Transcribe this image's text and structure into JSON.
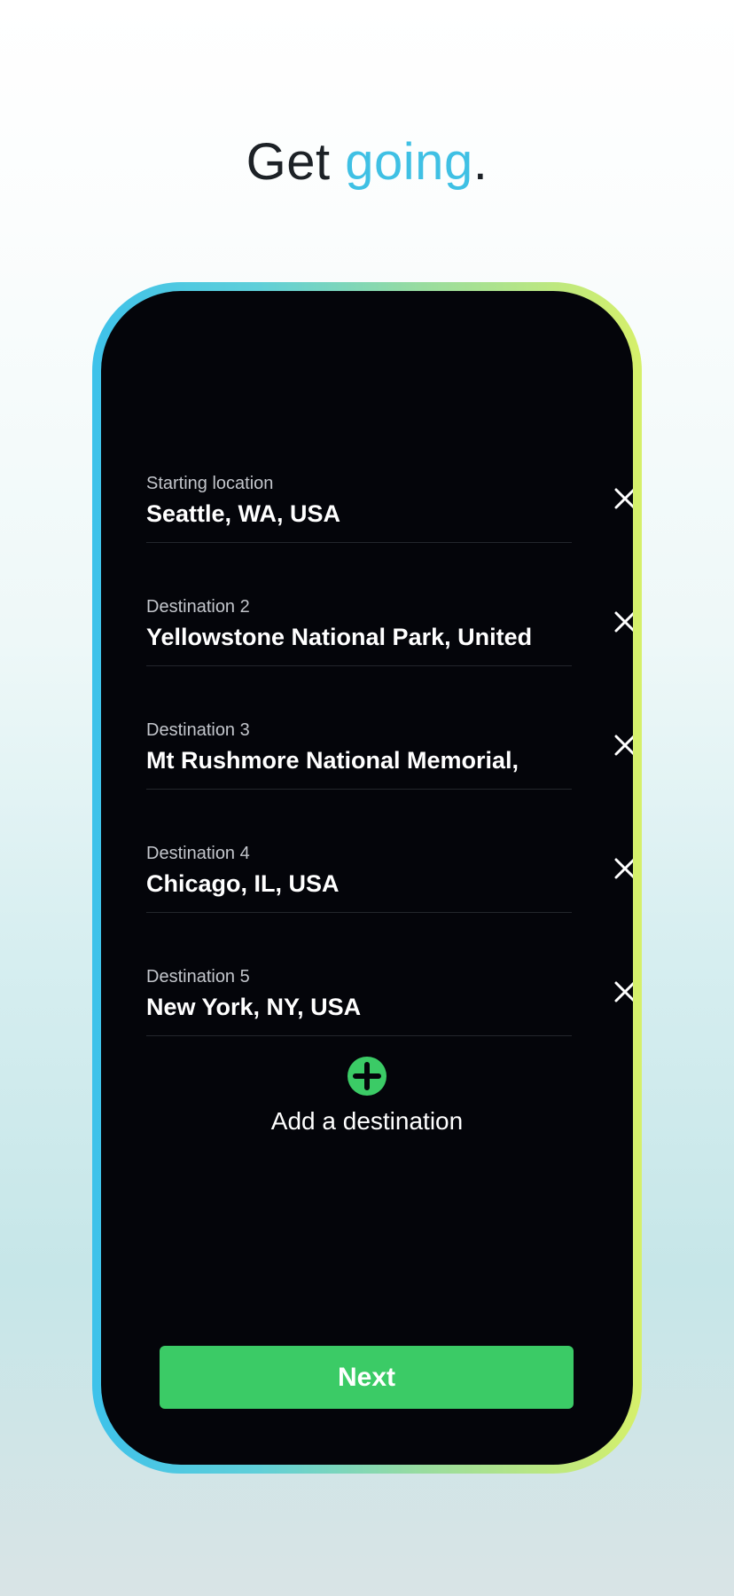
{
  "headline": {
    "part1": "Get ",
    "accent": "going",
    "part2": "."
  },
  "colors": {
    "accent": "#3fc0e4",
    "primary_button": "#3bcb66",
    "screen_background": "#04050a",
    "frame_gradient_start": "#3ec2ea",
    "frame_gradient_end": "#d6f06a"
  },
  "route": {
    "fields": [
      {
        "label": "Starting location",
        "value": "Seattle, WA, USA",
        "clear_icon": "close-icon"
      },
      {
        "label": "Destination 2",
        "value": "Yellowstone National Park, United",
        "clear_icon": "close-icon"
      },
      {
        "label": "Destination 3",
        "value": "Mt Rushmore National Memorial,",
        "clear_icon": "close-icon"
      },
      {
        "label": "Destination 4",
        "value": "Chicago, IL, USA",
        "clear_icon": "close-icon"
      },
      {
        "label": "Destination 5",
        "value": "New York, NY, USA",
        "clear_icon": "close-icon"
      }
    ],
    "add_destination": {
      "icon": "plus-circle-icon",
      "label": "Add a destination"
    }
  },
  "actions": {
    "next_label": "Next"
  }
}
